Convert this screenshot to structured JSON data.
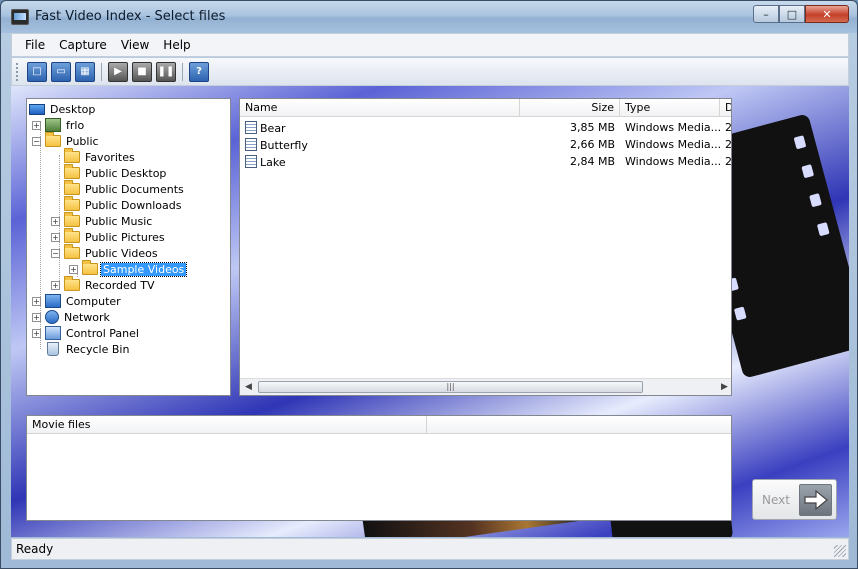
{
  "window": {
    "title": "Fast Video Index - Select files"
  },
  "menu": [
    "File",
    "Capture",
    "View",
    "Help"
  ],
  "toolbar": {
    "buttons": [
      "new-icon",
      "open-icon",
      "save-icon",
      "play-icon",
      "stop-icon",
      "pause-icon",
      "help-icon"
    ]
  },
  "tree": {
    "items": [
      {
        "label": "Desktop",
        "icon": "desktop-icon",
        "expander": ""
      },
      {
        "label": "frlo",
        "icon": "user-folder-icon",
        "expander": "+"
      },
      {
        "label": "Public",
        "icon": "folder-icon",
        "expander": "−"
      },
      {
        "label": "Favorites",
        "icon": "folder-icon",
        "expander": ""
      },
      {
        "label": "Public Desktop",
        "icon": "folder-icon",
        "expander": ""
      },
      {
        "label": "Public Documents",
        "icon": "folder-icon",
        "expander": ""
      },
      {
        "label": "Public Downloads",
        "icon": "folder-icon",
        "expander": ""
      },
      {
        "label": "Public Music",
        "icon": "music-folder-icon",
        "expander": "+"
      },
      {
        "label": "Public Pictures",
        "icon": "pictures-folder-icon",
        "expander": "+"
      },
      {
        "label": "Public Videos",
        "icon": "videos-folder-icon",
        "expander": "−"
      },
      {
        "label": "Sample Videos",
        "icon": "folder-icon",
        "expander": "+",
        "selected": true
      },
      {
        "label": "Recorded TV",
        "icon": "folder-icon",
        "expander": "+"
      },
      {
        "label": "Computer",
        "icon": "computer-icon",
        "expander": "+"
      },
      {
        "label": "Network",
        "icon": "network-icon",
        "expander": "+"
      },
      {
        "label": "Control Panel",
        "icon": "control-panel-icon",
        "expander": "+"
      },
      {
        "label": "Recycle Bin",
        "icon": "recycle-bin-icon",
        "expander": ""
      }
    ]
  },
  "file_list": {
    "columns": [
      "Name",
      "Size",
      "Type",
      "D"
    ],
    "rows": [
      {
        "name": "Bear",
        "size": "3,85 MB",
        "type": "Windows Media...",
        "date": "2"
      },
      {
        "name": "Butterfly",
        "size": "2,66 MB",
        "type": "Windows Media...",
        "date": "2"
      },
      {
        "name": "Lake",
        "size": "2,84 MB",
        "type": "Windows Media...",
        "date": "2"
      }
    ]
  },
  "movie_panel": {
    "columns": [
      "Movie files",
      ""
    ]
  },
  "next_button": {
    "label": "Next"
  },
  "status": {
    "text": "Ready"
  }
}
